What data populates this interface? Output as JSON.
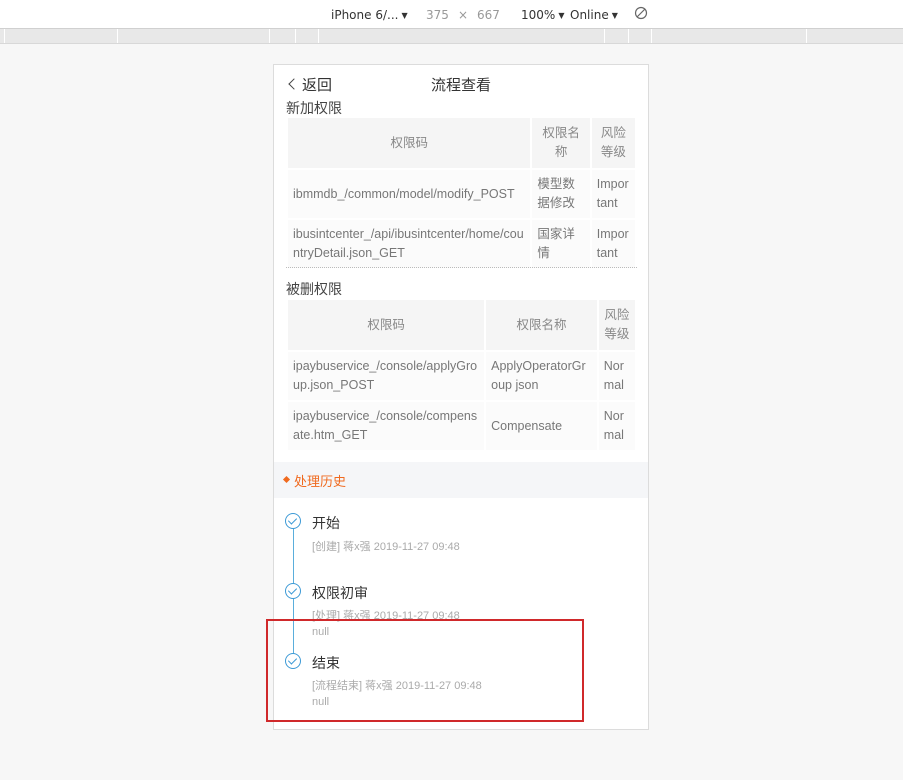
{
  "devtools": {
    "device": "iPhone 6/...",
    "width": "375",
    "times": "×",
    "height": "667",
    "zoom": "100%",
    "network": "Online",
    "rotate_icon": "rotate-icon",
    "caret_icon": "caret-down-icon"
  },
  "nav": {
    "back_label": "返回",
    "title": "流程查看"
  },
  "added": {
    "label": "新加权限",
    "headers": [
      "权限码",
      "权限名称",
      "风险等级"
    ],
    "rows": [
      [
        "ibmmdb_/common/model/modify_POST",
        "模型数据修改",
        "Important"
      ],
      [
        "ibusintcenter_/api/ibusintcenter/home/countryDetail.json_GET",
        "国家详情",
        "Important"
      ]
    ]
  },
  "removed": {
    "label": "被删权限",
    "headers": [
      "权限码",
      "权限名称",
      "风险等级"
    ],
    "rows": [
      [
        "ipaybuservice_/console/applyGroup.json_POST",
        "ApplyOperatorGroup json",
        "Normal"
      ],
      [
        "ipaybuservice_/console/compensate.htm_GET",
        "Compensate",
        "Normal"
      ]
    ]
  },
  "history": {
    "title": "处理历史",
    "items": [
      {
        "title": "开始",
        "meta": "[创建] 蒋x强 2019-11-27 09:48",
        "note": ""
      },
      {
        "title": "权限初审",
        "meta": "[处理] 蒋x强 2019-11-27 09:48",
        "note": "null"
      },
      {
        "title": "结束",
        "meta": "[流程结束] 蒋x强 2019-11-27 09:48",
        "note": "null"
      }
    ]
  },
  "colors": {
    "accent": "#f06a1f",
    "timeline": "#3d9ad6",
    "highlight": "#d0292b"
  }
}
